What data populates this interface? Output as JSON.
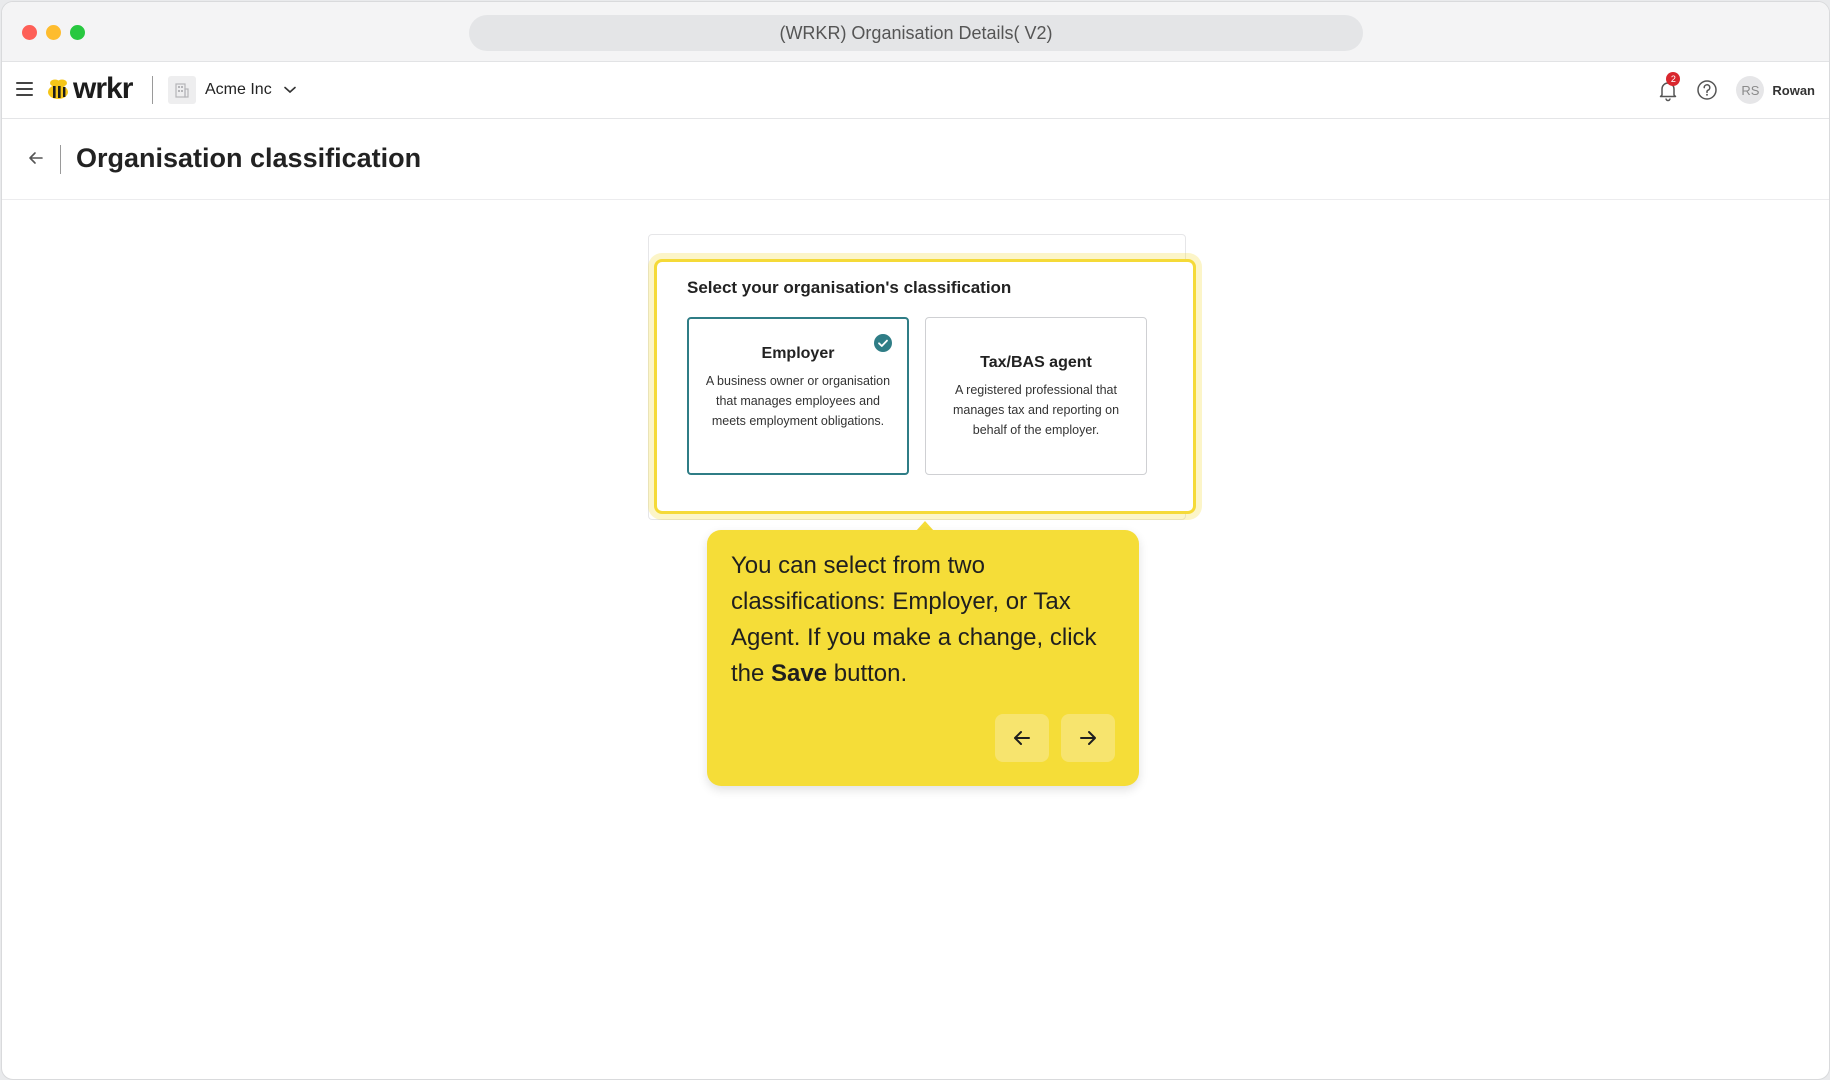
{
  "window": {
    "title": "(WRKR) Organisation Details( V2)"
  },
  "header": {
    "logo_text": "wrkr",
    "org_name": "Acme Inc",
    "notification_count": "2",
    "user_initials": "RS",
    "user_name": "Rowan"
  },
  "page": {
    "title": "Organisation classification"
  },
  "classification": {
    "heading": "Select your organisation's classification",
    "selected": "Employer",
    "options": [
      {
        "title": "Employer",
        "description": "A business owner or organisation that manages employees and meets employment obligations."
      },
      {
        "title": "Tax/BAS agent",
        "description": "A registered professional that manages tax and reporting on behalf of the employer."
      }
    ]
  },
  "tooltip": {
    "text_before": "You can select from two classifications: Employer, or Tax Agent. If you make a change, click the ",
    "text_bold": "Save",
    "text_after": " button."
  },
  "colors": {
    "accent_teal": "#2f7d86",
    "tooltip_yellow": "#f5dd38",
    "badge_red": "#d9272e"
  }
}
